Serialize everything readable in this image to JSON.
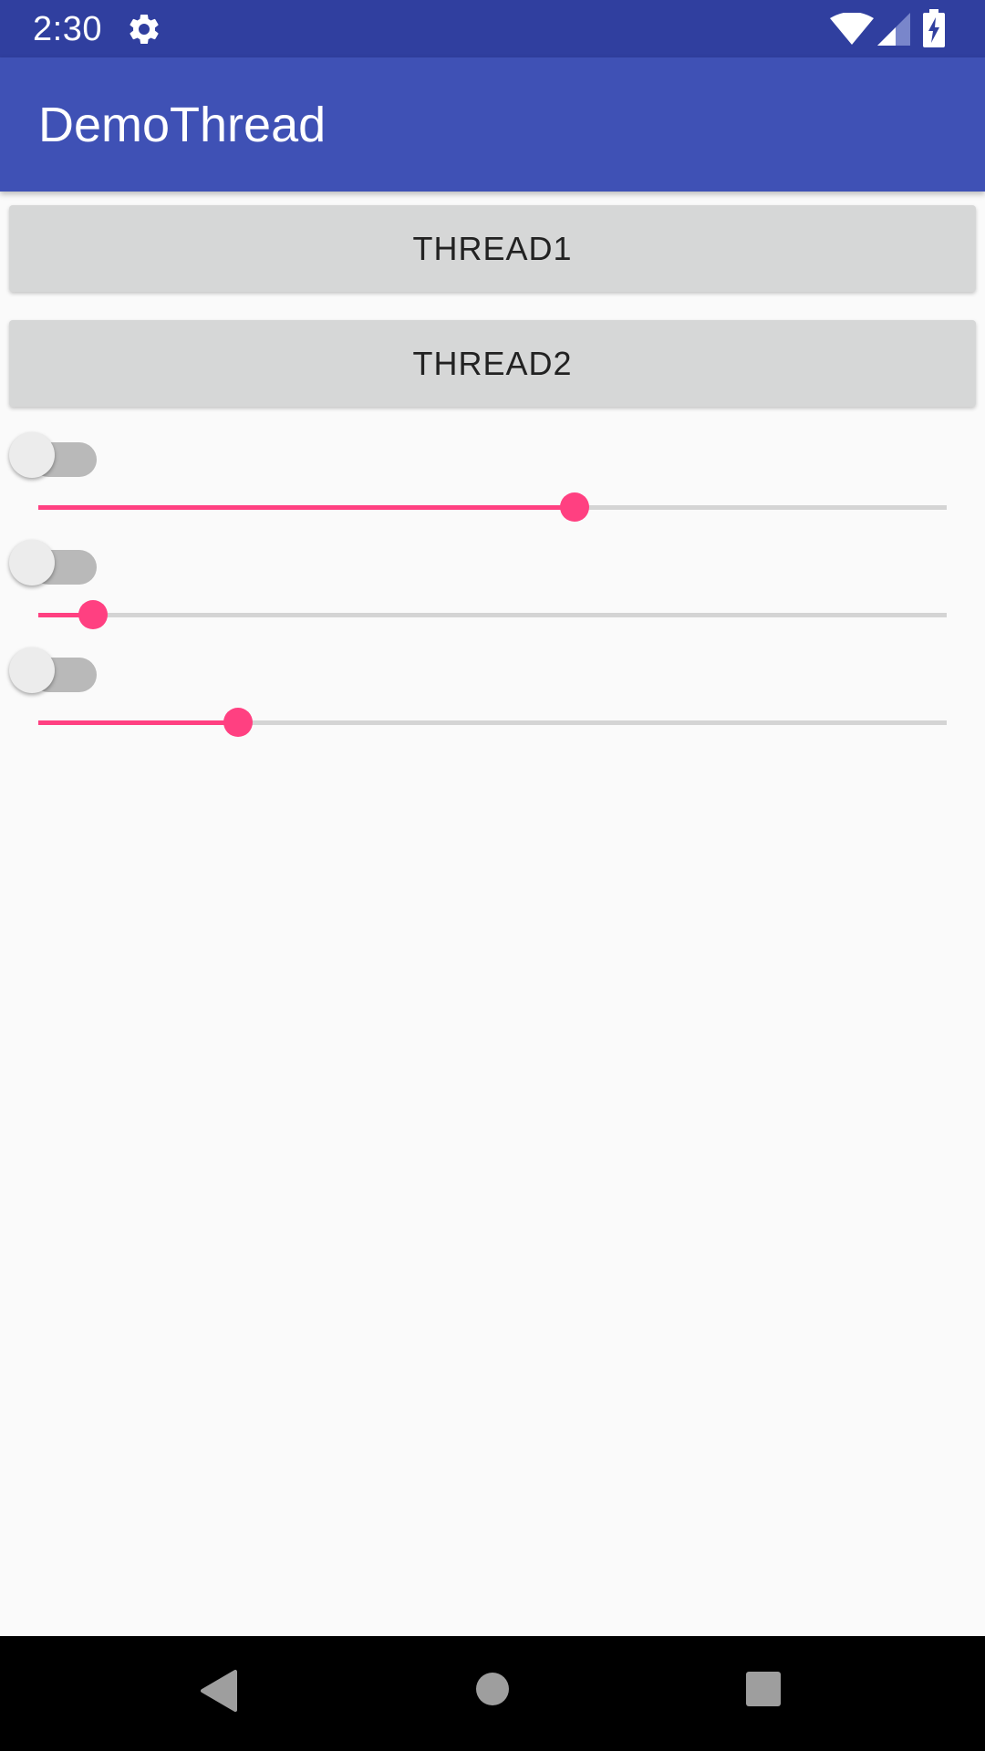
{
  "status_bar": {
    "time": "2:30",
    "icons": [
      "settings-gear-icon",
      "wifi-icon",
      "cell-signal-icon",
      "battery-charging-icon"
    ],
    "background": "#303f9f"
  },
  "app_bar": {
    "title": "DemoThread",
    "background": "#3f51b5"
  },
  "buttons": [
    {
      "label": "THREAD1"
    },
    {
      "label": "THREAD2"
    }
  ],
  "switches": [
    {
      "checked": false
    },
    {
      "checked": false
    },
    {
      "checked": false
    }
  ],
  "sliders": [
    {
      "value_fraction": 0.59
    },
    {
      "value_fraction": 0.06
    },
    {
      "value_fraction": 0.22
    }
  ],
  "colors": {
    "accent": "#ff4081",
    "button_bg": "#d6d7d7",
    "page_bg": "#fafafa"
  },
  "nav_bar": {
    "icons": [
      "back-icon",
      "home-icon",
      "recents-icon"
    ]
  }
}
